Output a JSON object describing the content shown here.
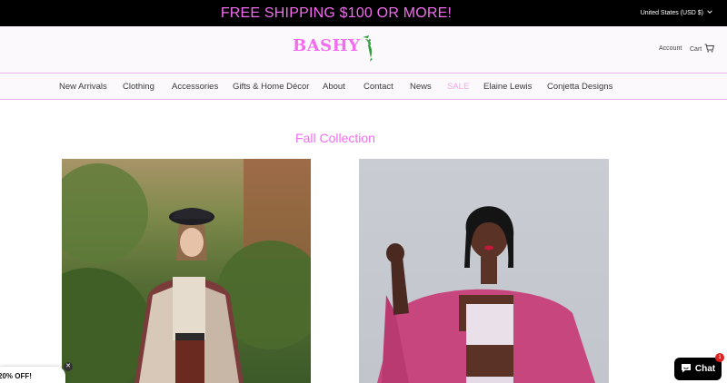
{
  "announcement": {
    "text": "FREE SHIPPING $100 OR MORE!"
  },
  "currency": {
    "label": "United States (USD $)",
    "icon": "chevron-down-icon"
  },
  "header": {
    "logo_text": "BASHY",
    "account_label": "Account",
    "cart_label": "Cart"
  },
  "nav": {
    "items": [
      {
        "label": "New Arrivals"
      },
      {
        "label": "Clothing"
      },
      {
        "label": "Accessories"
      },
      {
        "label": "Gifts & Home Décor"
      },
      {
        "label": "About"
      },
      {
        "label": "Contact"
      },
      {
        "label": "News"
      },
      {
        "label": "SALE"
      },
      {
        "label": "Elaine Lewis"
      },
      {
        "label": "Conjetta Designs"
      }
    ]
  },
  "main": {
    "section_title": "Fall Collection"
  },
  "popup": {
    "text": "20% OFF!"
  },
  "chat": {
    "label": "Chat",
    "badge": "1"
  },
  "colors": {
    "accent": "#f36cf0",
    "sale": "#f3a8ef",
    "divider": "#e6b4e8"
  }
}
